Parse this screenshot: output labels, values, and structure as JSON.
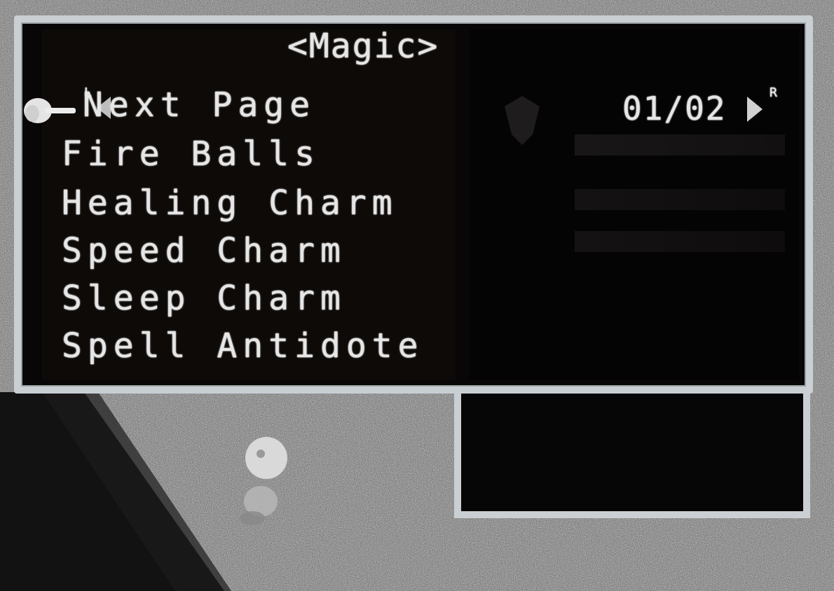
{
  "menu": {
    "title": "<Magic>",
    "page_indicator_left": "L",
    "page_indicator_right": "R",
    "page_counter": "01/02",
    "items": [
      {
        "label": "Next Page"
      },
      {
        "label": "Fire Balls"
      },
      {
        "label": "Healing Charm"
      },
      {
        "label": "Speed Charm"
      },
      {
        "label": "Sleep Charm"
      },
      {
        "label": "Spell Antidote"
      }
    ],
    "selected_index": 0
  },
  "colors": {
    "window_border": "#c9cfd3",
    "window_fill": "#080606",
    "text": "#e6e6e6"
  },
  "icons": {
    "cursor": "pointing-hand-icon",
    "prev_page": "triangle-left-icon",
    "next_page": "triangle-right-icon"
  }
}
